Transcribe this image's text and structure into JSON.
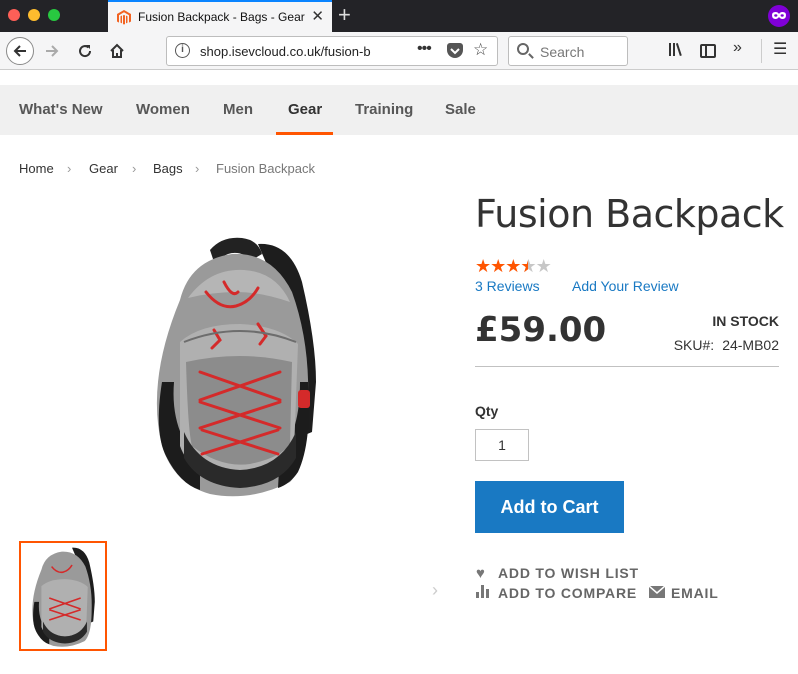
{
  "browser": {
    "tab_title": "Fusion Backpack - Bags - Gear",
    "url": "shop.isevcloud.co.uk/fusion-b",
    "search_placeholder": "Search",
    "new_tab_symbol": "+",
    "close_tab_symbol": "✕",
    "url_more_symbol": "•••",
    "icons": [
      "back-icon",
      "forward-icon",
      "reload-icon",
      "home-icon",
      "info-icon",
      "pocket-icon",
      "bookmark-star-icon",
      "search-icon",
      "library-icon",
      "sidebar-icon",
      "overflow-icon",
      "menu-icon",
      "private-browsing-icon"
    ]
  },
  "nav": {
    "items": [
      "What's New",
      "Women",
      "Men",
      "Gear",
      "Training",
      "Sale"
    ],
    "active": "Gear",
    "active_color": "#ff5501"
  },
  "breadcrumb": {
    "items": [
      "Home",
      "Gear",
      "Bags",
      "Fusion Backpack"
    ],
    "separator": "›"
  },
  "product": {
    "title": "Fusion Backpack",
    "rating": 3.5,
    "rating_max": 5,
    "reviews_label": "3 Reviews",
    "add_review_label": "Add Your Review",
    "price": "£59.00",
    "stock": "IN STOCK",
    "sku_label": "SKU#:",
    "sku": "24-MB02",
    "qty_label": "Qty",
    "qty_value": "1",
    "add_to_cart_label": "Add to Cart",
    "wishlist_label": "ADD TO WISH LIST",
    "compare_label": "ADD TO COMPARE",
    "email_label": "EMAIL"
  },
  "colors": {
    "accent": "#ff5501",
    "primary_button": "#1979c3",
    "link": "#1979c3"
  }
}
